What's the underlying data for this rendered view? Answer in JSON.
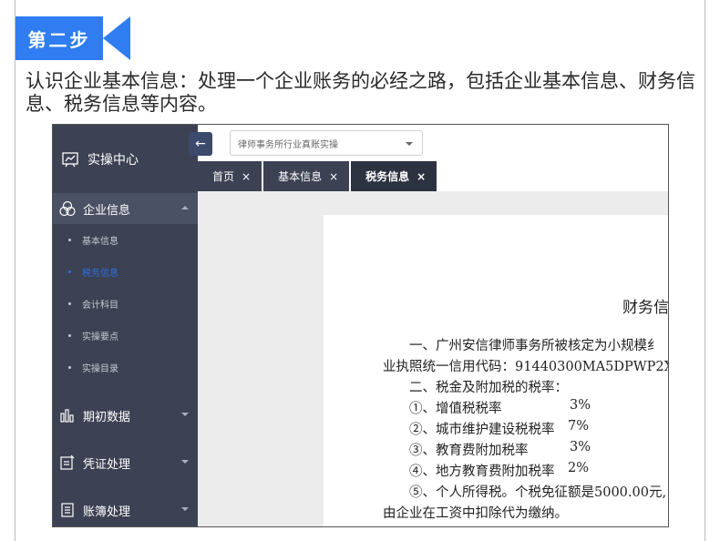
{
  "step": {
    "label": "第二步"
  },
  "intro": "认识企业基本信息：处理一个企业账务的必经之路，包括企业基本信息、财务信息、税务信息等内容。",
  "app": {
    "brand": "实操中心",
    "company_select": "律师事务所行业真账实操",
    "sidebar": {
      "groups": [
        {
          "label": "企业信息",
          "items": [
            "基本信息",
            "税务信息",
            "会计科目",
            "实操要点",
            "实操目录"
          ]
        },
        {
          "label": "期初数据"
        },
        {
          "label": "凭证处理"
        },
        {
          "label": "账簿处理"
        }
      ]
    },
    "tabs": [
      {
        "label": "首页",
        "close": "×"
      },
      {
        "label": "基本信息",
        "close": "×"
      },
      {
        "label": "税务信息",
        "close": "×"
      }
    ],
    "document": {
      "title": "财务信",
      "lines": [
        "一、广州安信律师事务所被核定为小规模纟",
        "业执照统一信用代码：91440300MA5DPWP2X",
        "二、税金及附加税的税率：",
        "①、增值税税率",
        "②、城市维护建设税税率",
        "③、教育费附加税率",
        "④、地方教育费附加税率",
        "⑤、个人所得税。个税免征额是5000.00元,",
        "由企业在工资中扣除代为缴纳。"
      ],
      "rates": [
        "3%",
        "7%",
        "3%",
        "2%"
      ]
    }
  }
}
